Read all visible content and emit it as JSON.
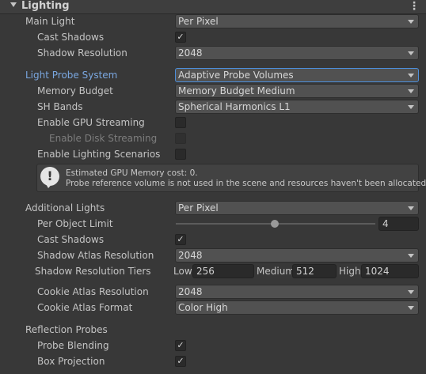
{
  "header": {
    "title": "Lighting",
    "menu_glyph": "⋮"
  },
  "main_light": {
    "label": "Main Light",
    "value": "Per Pixel",
    "cast_shadows_label": "Cast Shadows",
    "cast_shadows": true,
    "shadow_resolution_label": "Shadow Resolution",
    "shadow_resolution": "2048"
  },
  "probe_system": {
    "label": "Light Probe System",
    "value": "Adaptive Probe Volumes",
    "memory_budget_label": "Memory Budget",
    "memory_budget": "Memory Budget Medium",
    "sh_bands_label": "SH Bands",
    "sh_bands": "Spherical Harmonics L1",
    "gpu_streaming_label": "Enable GPU Streaming",
    "gpu_streaming": false,
    "disk_streaming_label": "Enable Disk Streaming",
    "disk_streaming": false,
    "lighting_scenarios_label": "Enable Lighting Scenarios",
    "lighting_scenarios": false,
    "help_icon": "!",
    "help_line1": "Estimated GPU Memory cost: 0.",
    "help_line2": "Probe reference volume is not used in the scene and resources haven't been allocated yet."
  },
  "additional_lights": {
    "label": "Additional Lights",
    "value": "Per Pixel",
    "per_object_limit_label": "Per Object Limit",
    "per_object_limit": "4",
    "per_object_limit_fraction": 0.5,
    "cast_shadows_label": "Cast Shadows",
    "cast_shadows": true,
    "atlas_resolution_label": "Shadow Atlas Resolution",
    "atlas_resolution": "2048",
    "tiers_label": "Shadow Resolution Tiers",
    "tier_low_label": "Low",
    "tier_low": "256",
    "tier_medium_label": "Medium",
    "tier_medium": "512",
    "tier_high_label": "High",
    "tier_high": "1024",
    "cookie_resolution_label": "Cookie Atlas Resolution",
    "cookie_resolution": "2048",
    "cookie_format_label": "Cookie Atlas Format",
    "cookie_format": "Color High"
  },
  "reflection_probes": {
    "label": "Reflection Probes",
    "blending_label": "Probe Blending",
    "blending": true,
    "box_projection_label": "Box Projection",
    "box_projection": true
  },
  "glyphs": {
    "check": "✓"
  }
}
